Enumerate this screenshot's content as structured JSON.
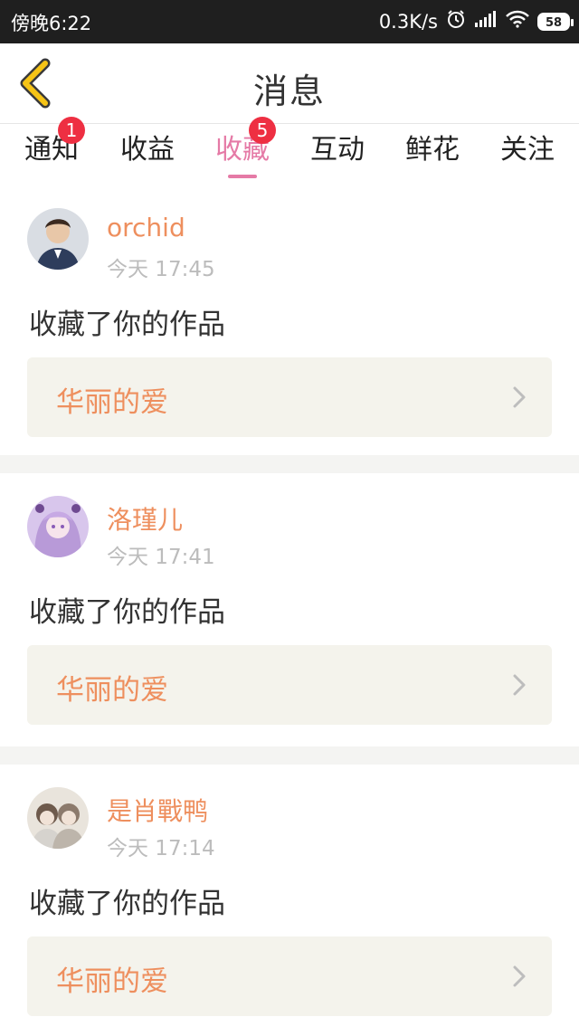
{
  "status_bar": {
    "time": "傍晚6:22",
    "net_speed": "0.3K/s",
    "battery": "58"
  },
  "header": {
    "title": "消息"
  },
  "tabs": [
    {
      "label": "通知",
      "badge": "1"
    },
    {
      "label": "收益",
      "badge": ""
    },
    {
      "label": "收藏",
      "badge": "5",
      "active": true
    },
    {
      "label": "互动",
      "badge": ""
    },
    {
      "label": "鲜花",
      "badge": ""
    },
    {
      "label": "关注",
      "badge": ""
    }
  ],
  "messages": [
    {
      "username": "orchid",
      "time": "今天 17:45",
      "action": "收藏了你的作品",
      "work_title": "华丽的爱"
    },
    {
      "username": "洛瑾儿",
      "time": "今天 17:41",
      "action": "收藏了你的作品",
      "work_title": "华丽的爱"
    },
    {
      "username": "是肖戰鸭",
      "time": "今天 17:14",
      "action": "收藏了你的作品",
      "work_title": "华丽的爱"
    }
  ],
  "colors": {
    "accent_pink": "#e57aa6",
    "accent_orange": "#ee8f5e",
    "badge_red": "#ee2f42",
    "back_arrow_yellow": "#f6c416"
  }
}
